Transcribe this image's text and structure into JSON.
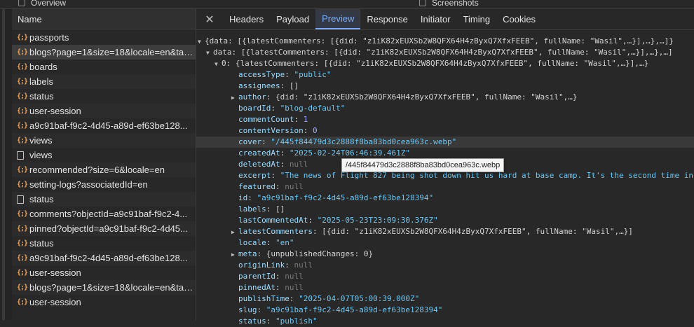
{
  "topbar": {
    "overview_label": "Overview",
    "screenshots_label": "Screenshots"
  },
  "requests": {
    "header": "Name",
    "items": [
      {
        "icon": "xhr-icon",
        "label": "passports"
      },
      {
        "icon": "xhr-icon",
        "label": "blogs?page=1&size=18&locale=en&tag..."
      },
      {
        "icon": "xhr-icon",
        "label": "boards"
      },
      {
        "icon": "xhr-icon",
        "label": "labels"
      },
      {
        "icon": "xhr-icon",
        "label": "status"
      },
      {
        "icon": "xhr-icon",
        "label": "user-session"
      },
      {
        "icon": "xhr-icon",
        "label": "a9c91baf-f9c2-4d45-a89d-ef63be128..."
      },
      {
        "icon": "xhr-icon",
        "label": "views"
      },
      {
        "icon": "document-icon",
        "label": "views"
      },
      {
        "icon": "xhr-icon",
        "label": "recommended?size=6&locale=en"
      },
      {
        "icon": "xhr-icon",
        "label": "setting-logs?associatedId=en"
      },
      {
        "icon": "document-icon",
        "label": "status"
      },
      {
        "icon": "xhr-icon",
        "label": "comments?objectId=a9c91baf-f9c2-4..."
      },
      {
        "icon": "xhr-icon",
        "label": "pinned?objectId=a9c91baf-f9c2-4d45..."
      },
      {
        "icon": "xhr-icon",
        "label": "status"
      },
      {
        "icon": "xhr-icon",
        "label": "a9c91baf-f9c2-4d45-a89d-ef63be128..."
      },
      {
        "icon": "xhr-icon",
        "label": "user-session"
      },
      {
        "icon": "xhr-icon",
        "label": "blogs?page=1&size=18&locale=en&tag..."
      },
      {
        "icon": "xhr-icon",
        "label": "user-session"
      }
    ]
  },
  "tabs": {
    "close": "✕",
    "items": [
      "Headers",
      "Payload",
      "Preview",
      "Response",
      "Initiator",
      "Timing",
      "Cookies"
    ],
    "active": "Preview"
  },
  "preview": {
    "lines": [
      {
        "indent": 0,
        "arrow": "down",
        "key": "",
        "text": "{data: [{latestCommenters: [{did: \"z1iK82xEUXSb2W8QFX64H4zByxQ7XfxFEEB\", fullName: \"Wasil\",…}],…},…]}",
        "type": "p"
      },
      {
        "indent": 1,
        "arrow": "down",
        "key": "data",
        "text": "[{latestCommenters: [{did: \"z1iK82xEUXSb2W8QFX64H4zByxQ7XfxFEEB\", fullName: \"Wasil\",…}],…},…]",
        "type": "p"
      },
      {
        "indent": 2,
        "arrow": "down",
        "key": "0",
        "text": "{latestCommenters: [{did: \"z1iK82xEUXSb2W8QFX64H4zByxQ7XfxFEEB\", fullName: \"Wasil\",…}],…}",
        "type": "p"
      },
      {
        "indent": 3,
        "arrow": "",
        "key": "accessType",
        "text": "\"public\"",
        "type": "s"
      },
      {
        "indent": 3,
        "arrow": "",
        "key": "assignees",
        "text": "[]",
        "type": "p"
      },
      {
        "indent": 3,
        "arrow": "right",
        "key": "author",
        "text": "{did: \"z1iK82xEUXSb2W8QFX64H4zByxQ7XfxFEEB\", fullName: \"Wasil\",…}",
        "type": "p"
      },
      {
        "indent": 3,
        "arrow": "",
        "key": "boardId",
        "text": "\"blog-default\"",
        "type": "s"
      },
      {
        "indent": 3,
        "arrow": "",
        "key": "commentCount",
        "text": "1",
        "type": "n"
      },
      {
        "indent": 3,
        "arrow": "",
        "key": "contentVersion",
        "text": "0",
        "type": "n"
      },
      {
        "indent": 3,
        "arrow": "",
        "key": "cover",
        "text": "\"/445f84479d3c2888f8ba83bd0cea963c.webp\"",
        "type": "s",
        "highlight": true
      },
      {
        "indent": 3,
        "arrow": "",
        "key": "createdAt",
        "text": "\"2025-02-24T06:46:39.461Z\"",
        "type": "s"
      },
      {
        "indent": 3,
        "arrow": "",
        "key": "deletedAt",
        "text": "null",
        "type": "nul"
      },
      {
        "indent": 3,
        "arrow": "",
        "key": "excerpt",
        "text": "\"The news of Flight 827 being shot down hit us hard at base camp. It's the second time in",
        "type": "s"
      },
      {
        "indent": 3,
        "arrow": "",
        "key": "featured",
        "text": "null",
        "type": "nul"
      },
      {
        "indent": 3,
        "arrow": "",
        "key": "id",
        "text": "\"a9c91baf-f9c2-4d45-a89d-ef63be128394\"",
        "type": "s"
      },
      {
        "indent": 3,
        "arrow": "",
        "key": "labels",
        "text": "[]",
        "type": "p"
      },
      {
        "indent": 3,
        "arrow": "",
        "key": "lastCommentedAt",
        "text": "\"2025-05-23T23:09:30.376Z\"",
        "type": "s"
      },
      {
        "indent": 3,
        "arrow": "right",
        "key": "latestCommenters",
        "text": "[{did: \"z1iK82xEUXSb2W8QFX64H4zByxQ7XfxFEEB\", fullName: \"Wasil\",…}]",
        "type": "p"
      },
      {
        "indent": 3,
        "arrow": "",
        "key": "locale",
        "text": "\"en\"",
        "type": "s"
      },
      {
        "indent": 3,
        "arrow": "right",
        "key": "meta",
        "text": "{unpublishedChanges: 0}",
        "type": "p"
      },
      {
        "indent": 3,
        "arrow": "",
        "key": "originLink",
        "text": "null",
        "type": "nul"
      },
      {
        "indent": 3,
        "arrow": "",
        "key": "parentId",
        "text": "null",
        "type": "nul"
      },
      {
        "indent": 3,
        "arrow": "",
        "key": "pinnedAt",
        "text": "null",
        "type": "nul"
      },
      {
        "indent": 3,
        "arrow": "",
        "key": "publishTime",
        "text": "\"2025-04-07T05:00:39.000Z\"",
        "type": "s"
      },
      {
        "indent": 3,
        "arrow": "",
        "key": "slug",
        "text": "\"a9c91baf-f9c2-4d45-a89d-ef63be128394\"",
        "type": "s"
      },
      {
        "indent": 3,
        "arrow": "",
        "key": "status",
        "text": "\"publish\"",
        "type": "s"
      }
    ],
    "tooltip": "/445f84479d3c2888f8ba83bd0cea963c.webp"
  },
  "colors": {
    "accent": "#7cacf8",
    "string": "#6ec6f0",
    "number": "#9fa8ff",
    "key": "#9cdcfe",
    "icon": "#f0a35b"
  }
}
